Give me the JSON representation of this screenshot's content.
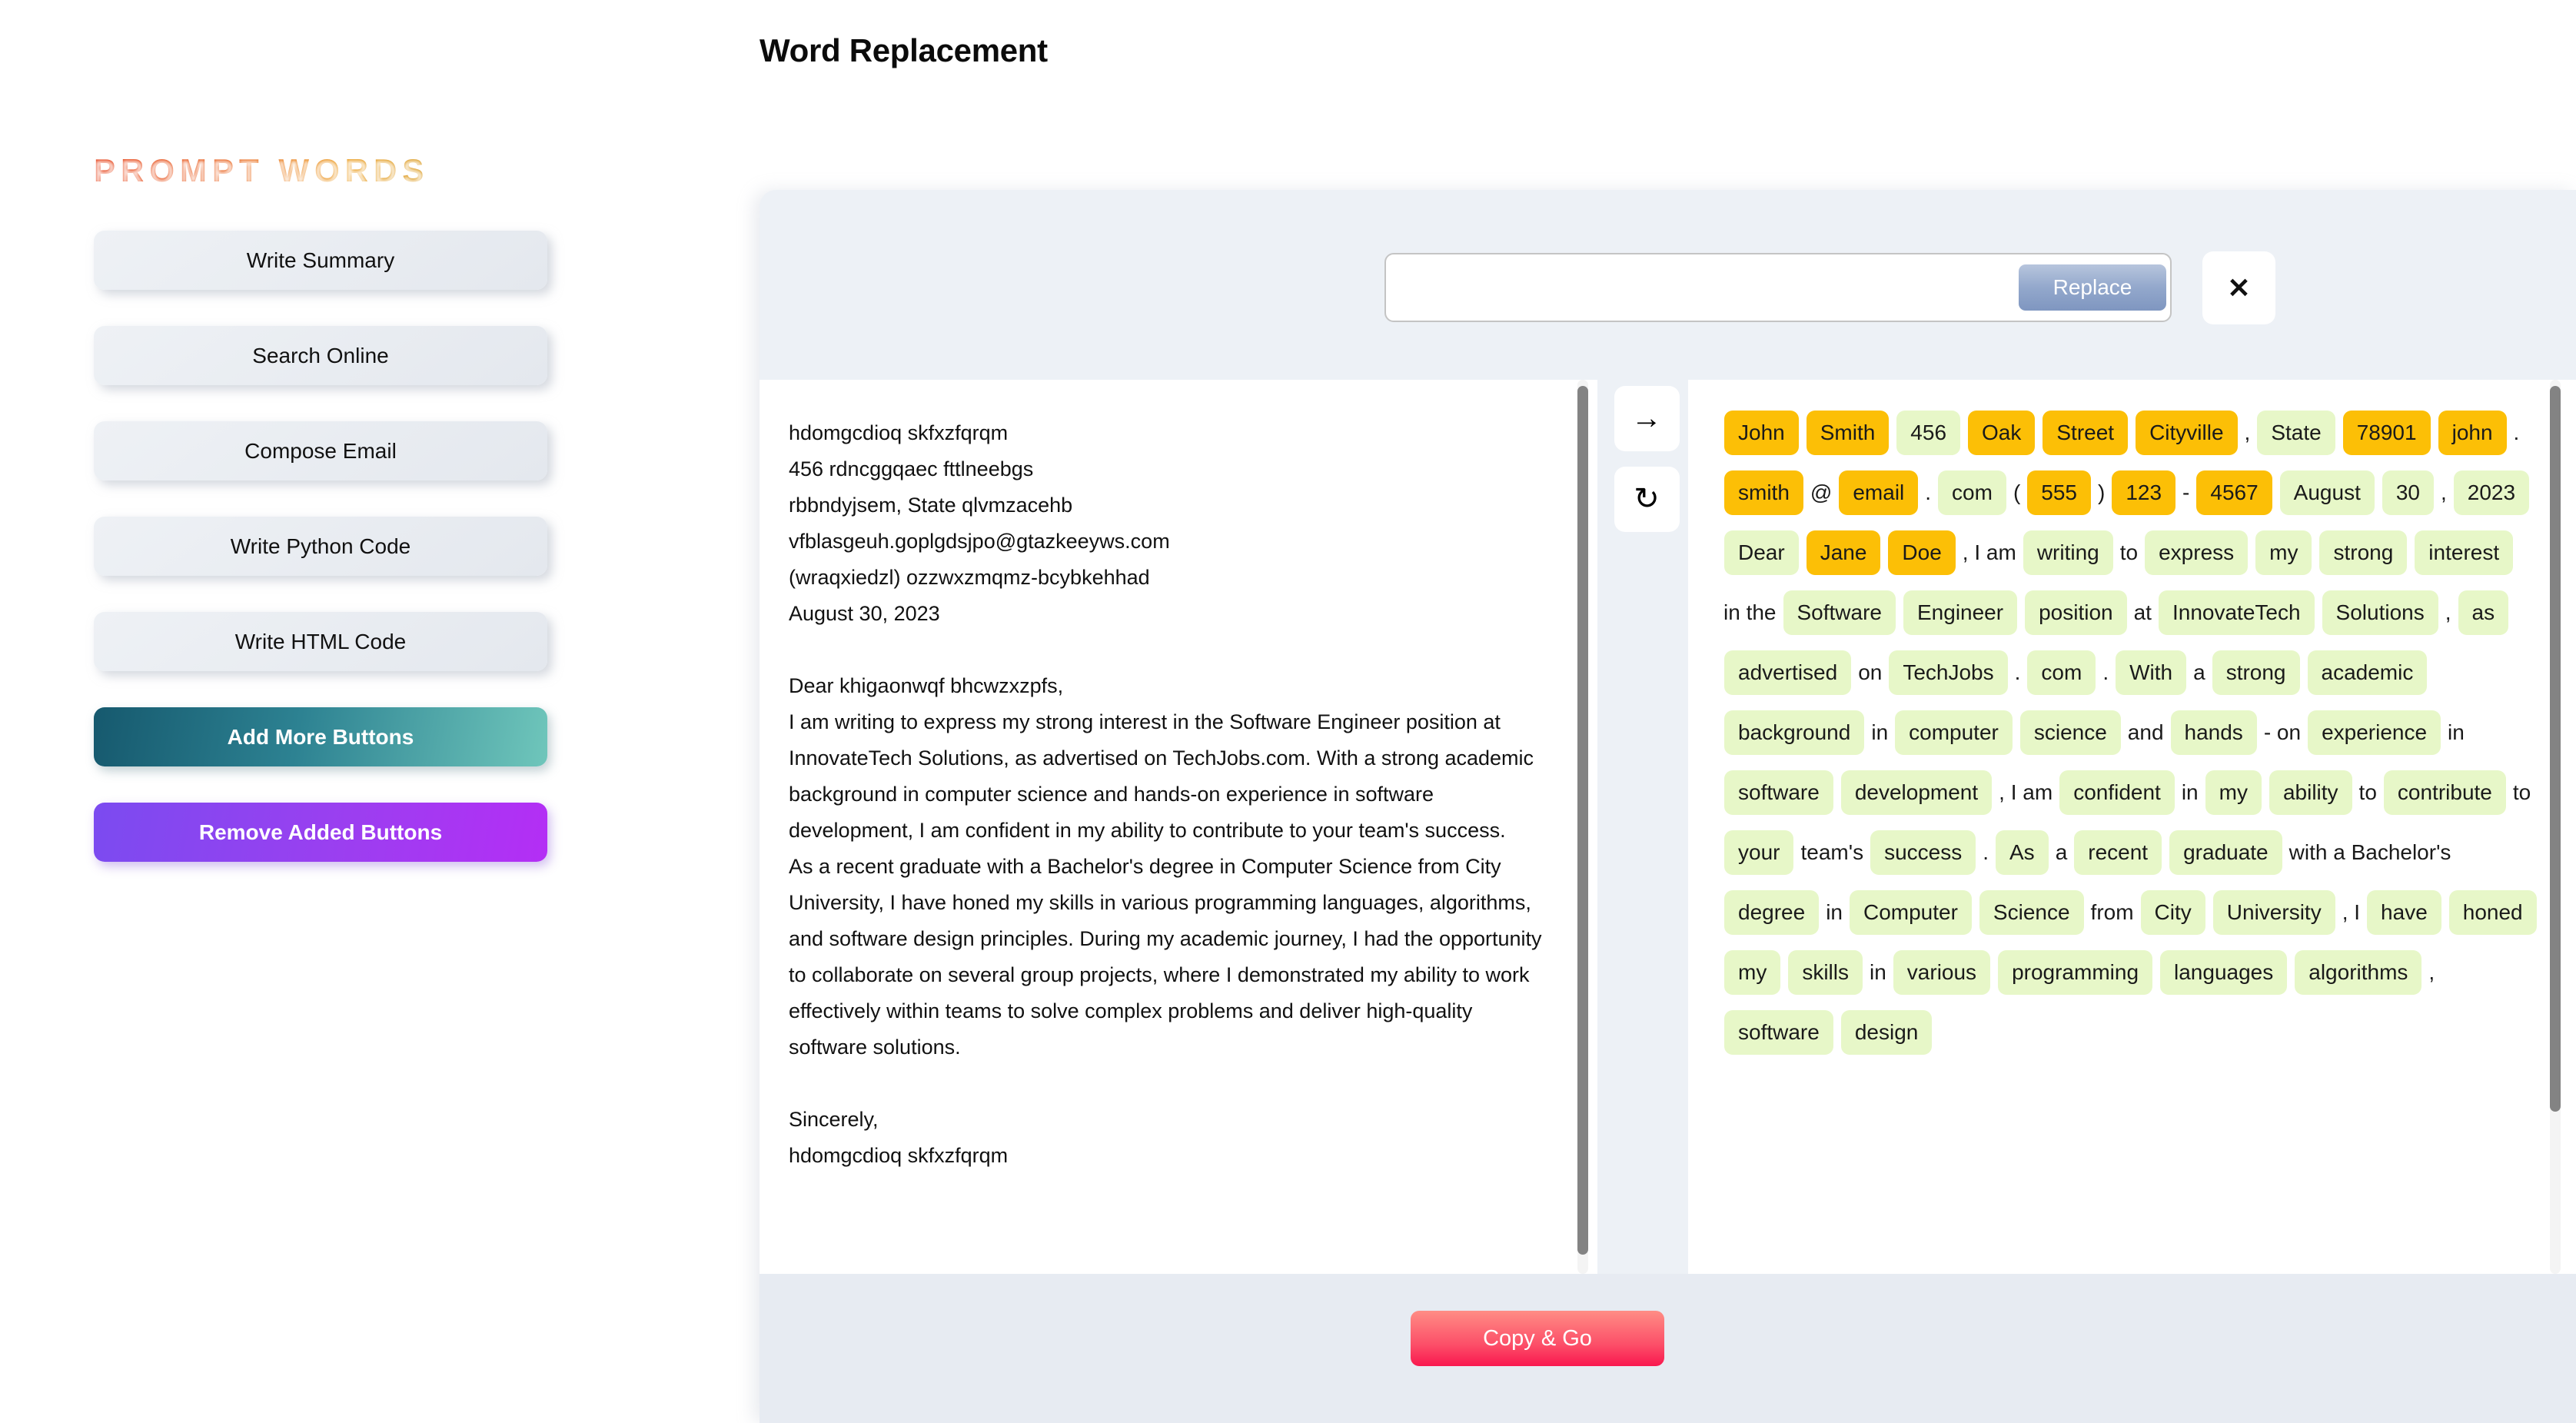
{
  "app": {
    "page_title": "Word Replacement"
  },
  "sidebar": {
    "heading": "PROMPT WORDS",
    "buttons": [
      {
        "label": "Write Summary",
        "style": "neutral"
      },
      {
        "label": "Search Online",
        "style": "neutral"
      },
      {
        "label": "Compose Email",
        "style": "neutral"
      },
      {
        "label": "Write Python Code",
        "style": "neutral"
      },
      {
        "label": "Write HTML Code",
        "style": "neutral"
      }
    ],
    "add_button": {
      "label": "Add More Buttons",
      "color": "#2d8292"
    },
    "remove_button": {
      "label": "Remove Added Buttons",
      "color": "#9b3ff0"
    }
  },
  "toolbar": {
    "search_value": "",
    "search_placeholder": "",
    "replace_label": "Replace",
    "close_label": "✕"
  },
  "editor": {
    "letter_text": "hdomgcdioq skfxzfqrqm\n456 rdncggqaec fttlneebgs\nrbbndyjsem, State qlvmzacehb\nvfblasgeuh.goplgdsjpo@gtazkeeyws.com\n(wraqxiedzl) ozzwxzmqmz-bcybkehhad\nAugust 30, 2023\n\nDear khigaonwqf bhcwzxzpfs,\nI am writing to express my strong interest in the Software Engineer position at InnovateTech Solutions, as advertised on TechJobs.com. With a strong academic background in computer science and hands-on experience in software development, I am confident in my ability to contribute to your team's success.\nAs a recent graduate with a Bachelor's degree in Computer Science from City University, I have honed my skills in various programming languages, algorithms, and software design principles. During my academic journey, I had the opportunity to collaborate on several group projects, where I demonstrated my ability to work effectively within teams to solve complex problems and deliver high-quality software solutions.\n\nSincerely,\nhdomgcdioq skfxzfqrqm"
  },
  "transfer_controls": {
    "forward_label": "→",
    "reset_label": "↻"
  },
  "tokens": {
    "colors": {
      "amber": "#fcbf06",
      "green": "#e7f7c8"
    },
    "items": [
      {
        "text": "John",
        "type": "amber"
      },
      {
        "text": "Smith",
        "type": "amber"
      },
      {
        "text": "456",
        "type": "green"
      },
      {
        "text": "Oak",
        "type": "amber"
      },
      {
        "text": "Street",
        "type": "amber"
      },
      {
        "text": "Cityville",
        "type": "amber"
      },
      {
        "text": ",",
        "type": "plain"
      },
      {
        "text": "State",
        "type": "green"
      },
      {
        "text": "78901",
        "type": "amber"
      },
      {
        "text": "john",
        "type": "amber"
      },
      {
        "text": ".",
        "type": "plain"
      },
      {
        "text": "smith",
        "type": "amber"
      },
      {
        "text": "@",
        "type": "plain"
      },
      {
        "text": "email",
        "type": "amber"
      },
      {
        "text": ".",
        "type": "plain"
      },
      {
        "text": "com",
        "type": "green"
      },
      {
        "text": "(",
        "type": "plain"
      },
      {
        "text": "555",
        "type": "amber"
      },
      {
        "text": ")",
        "type": "plain"
      },
      {
        "text": "123",
        "type": "amber"
      },
      {
        "text": "-",
        "type": "plain"
      },
      {
        "text": "4567",
        "type": "amber"
      },
      {
        "text": "August",
        "type": "green"
      },
      {
        "text": "30",
        "type": "green"
      },
      {
        "text": ",",
        "type": "plain"
      },
      {
        "text": "2023",
        "type": "green"
      },
      {
        "text": "Dear",
        "type": "green"
      },
      {
        "text": "Jane",
        "type": "amber"
      },
      {
        "text": "Doe",
        "type": "amber"
      },
      {
        "text": ", I am",
        "type": "plain"
      },
      {
        "text": "writing",
        "type": "green"
      },
      {
        "text": "to",
        "type": "plain"
      },
      {
        "text": "express",
        "type": "green"
      },
      {
        "text": "my",
        "type": "green"
      },
      {
        "text": "strong",
        "type": "green"
      },
      {
        "text": "interest",
        "type": "green"
      },
      {
        "text": "in the",
        "type": "plain"
      },
      {
        "text": "Software",
        "type": "green"
      },
      {
        "text": "Engineer",
        "type": "green"
      },
      {
        "text": "position",
        "type": "green"
      },
      {
        "text": "at",
        "type": "plain"
      },
      {
        "text": "InnovateTech",
        "type": "green"
      },
      {
        "text": "Solutions",
        "type": "green"
      },
      {
        "text": ",",
        "type": "plain"
      },
      {
        "text": "as",
        "type": "green"
      },
      {
        "text": "advertised",
        "type": "green"
      },
      {
        "text": "on",
        "type": "plain"
      },
      {
        "text": "TechJobs",
        "type": "green"
      },
      {
        "text": ".",
        "type": "plain"
      },
      {
        "text": "com",
        "type": "green"
      },
      {
        "text": ".",
        "type": "plain"
      },
      {
        "text": "With",
        "type": "green"
      },
      {
        "text": "a",
        "type": "plain"
      },
      {
        "text": "strong",
        "type": "green"
      },
      {
        "text": "academic",
        "type": "green"
      },
      {
        "text": "background",
        "type": "green"
      },
      {
        "text": "in",
        "type": "plain"
      },
      {
        "text": "computer",
        "type": "green"
      },
      {
        "text": "science",
        "type": "green"
      },
      {
        "text": "and",
        "type": "plain"
      },
      {
        "text": "hands",
        "type": "green"
      },
      {
        "text": "- on",
        "type": "plain"
      },
      {
        "text": "experience",
        "type": "green"
      },
      {
        "text": "in",
        "type": "plain"
      },
      {
        "text": "software",
        "type": "green"
      },
      {
        "text": "development",
        "type": "green"
      },
      {
        "text": ", I am",
        "type": "plain"
      },
      {
        "text": "confident",
        "type": "green"
      },
      {
        "text": "in",
        "type": "plain"
      },
      {
        "text": "my",
        "type": "green"
      },
      {
        "text": "ability",
        "type": "green"
      },
      {
        "text": "to",
        "type": "plain"
      },
      {
        "text": "contribute",
        "type": "green"
      },
      {
        "text": "to",
        "type": "plain"
      },
      {
        "text": "your",
        "type": "green"
      },
      {
        "text": "team's",
        "type": "plain"
      },
      {
        "text": "success",
        "type": "green"
      },
      {
        "text": ".",
        "type": "plain"
      },
      {
        "text": "As",
        "type": "green"
      },
      {
        "text": "a",
        "type": "plain"
      },
      {
        "text": "recent",
        "type": "green"
      },
      {
        "text": "graduate",
        "type": "green"
      },
      {
        "text": "with a Bachelor's",
        "type": "plain"
      },
      {
        "text": "degree",
        "type": "green"
      },
      {
        "text": "in",
        "type": "plain"
      },
      {
        "text": "Computer",
        "type": "green"
      },
      {
        "text": "Science",
        "type": "green"
      },
      {
        "text": "from",
        "type": "plain"
      },
      {
        "text": "City",
        "type": "green"
      },
      {
        "text": "University",
        "type": "green"
      },
      {
        "text": ", I",
        "type": "plain"
      },
      {
        "text": "have",
        "type": "green"
      },
      {
        "text": "honed",
        "type": "green"
      },
      {
        "text": "my",
        "type": "green"
      },
      {
        "text": "skills",
        "type": "green"
      },
      {
        "text": "in",
        "type": "plain"
      },
      {
        "text": "various",
        "type": "green"
      },
      {
        "text": "programming",
        "type": "green"
      },
      {
        "text": "languages",
        "type": "green"
      },
      {
        "text": "algorithms",
        "type": "green"
      },
      {
        "text": ",",
        "type": "plain"
      },
      {
        "text": "software",
        "type": "green"
      },
      {
        "text": "design",
        "type": "green"
      }
    ]
  },
  "footer": {
    "copy_label": "Copy & Go"
  }
}
